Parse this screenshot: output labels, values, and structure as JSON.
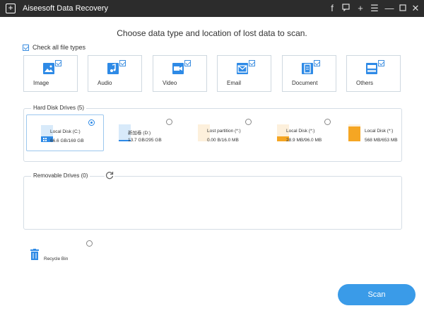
{
  "window": {
    "title": "Aiseesoft Data Recovery",
    "controls": [
      "f",
      "message",
      "+",
      "menu",
      "minimize",
      "maximize",
      "close"
    ]
  },
  "heading": "Choose data type and location of lost data to scan.",
  "check_all": {
    "label": "Check all file types",
    "checked": true
  },
  "file_types": [
    {
      "label": "Image",
      "icon": "image-icon",
      "checked": true
    },
    {
      "label": "Audio",
      "icon": "audio-icon",
      "checked": true
    },
    {
      "label": "Video",
      "icon": "video-icon",
      "checked": true
    },
    {
      "label": "Email",
      "icon": "email-icon",
      "checked": true
    },
    {
      "label": "Document",
      "icon": "document-icon",
      "checked": true
    },
    {
      "label": "Others",
      "icon": "others-icon",
      "checked": true
    }
  ],
  "hard_disk": {
    "label": "Hard Disk Drives (5)",
    "drives": [
      {
        "name": "Local Disk (C:)",
        "size": "66.6 GB/169 GB",
        "selected": true,
        "fill_fraction": 0.39,
        "color": "#2e8ae6"
      },
      {
        "name": "新加卷 (D:)",
        "size": "13.7 GB/295 GB",
        "selected": false,
        "fill_fraction": 0.05,
        "color": "#2e8ae6"
      },
      {
        "name": "Lost partition (*:)",
        "size": "0.00  B/16.0 MB",
        "selected": false,
        "fill_fraction": 0.0,
        "color": "#f5a623"
      },
      {
        "name": "Local Disk (*:)",
        "size": "28.9 MB/96.0 MB",
        "selected": false,
        "fill_fraction": 0.3,
        "color": "#f5a623"
      },
      {
        "name": "Local Disk (*:)",
        "size": "568 MB/653 MB",
        "selected": false,
        "fill_fraction": 0.87,
        "color": "#f5a623"
      }
    ]
  },
  "removable": {
    "label": "Removable Drives (0)"
  },
  "recycle_bin": {
    "label": "Recycle Bin",
    "selected": false
  },
  "scan_button": "Scan",
  "colors": {
    "accent": "#3a9be8",
    "titlebar": "#2c2c2c"
  }
}
